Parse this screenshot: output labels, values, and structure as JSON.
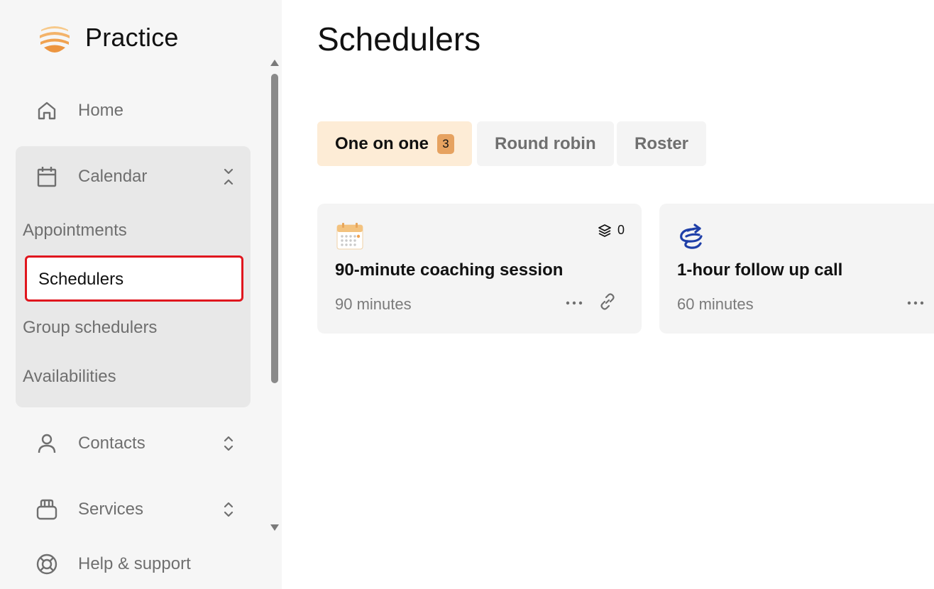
{
  "brand": {
    "name": "Practice",
    "logo_icon": "sunrise-logo",
    "logo_color": "#f0a250"
  },
  "nav": {
    "home": {
      "label": "Home",
      "icon": "home-icon"
    },
    "calendar": {
      "label": "Calendar",
      "icon": "calendar-icon",
      "expanded": true,
      "sub_items": [
        "Appointments",
        "Schedulers",
        "Group schedulers",
        "Availabilities"
      ],
      "active_sub_item": "Schedulers"
    },
    "contacts": {
      "label": "Contacts",
      "icon": "person-icon"
    },
    "services": {
      "label": "Services",
      "icon": "services-icon"
    },
    "help": {
      "label": "Help & support",
      "icon": "lifebuoy-icon"
    }
  },
  "page": {
    "title": "Schedulers"
  },
  "tabs": [
    {
      "label": "One on one",
      "badge": "3",
      "active": true
    },
    {
      "label": "Round robin",
      "active": false
    },
    {
      "label": "Roster",
      "active": false
    }
  ],
  "cards": [
    {
      "title": "90-minute coaching session",
      "duration": "90 minutes",
      "layers_count": "0",
      "icon": "calendar-grid-icon"
    },
    {
      "title": "1-hour follow up call",
      "duration": "60 minutes",
      "icon": "spiral-arrow-icon"
    }
  ],
  "colors": {
    "accent": "#f0a250",
    "tab_active_bg": "#fdecd6",
    "badge_bg": "#e6a260",
    "highlight_border": "#e0161e",
    "spiral_icon": "#1f3fa8"
  }
}
